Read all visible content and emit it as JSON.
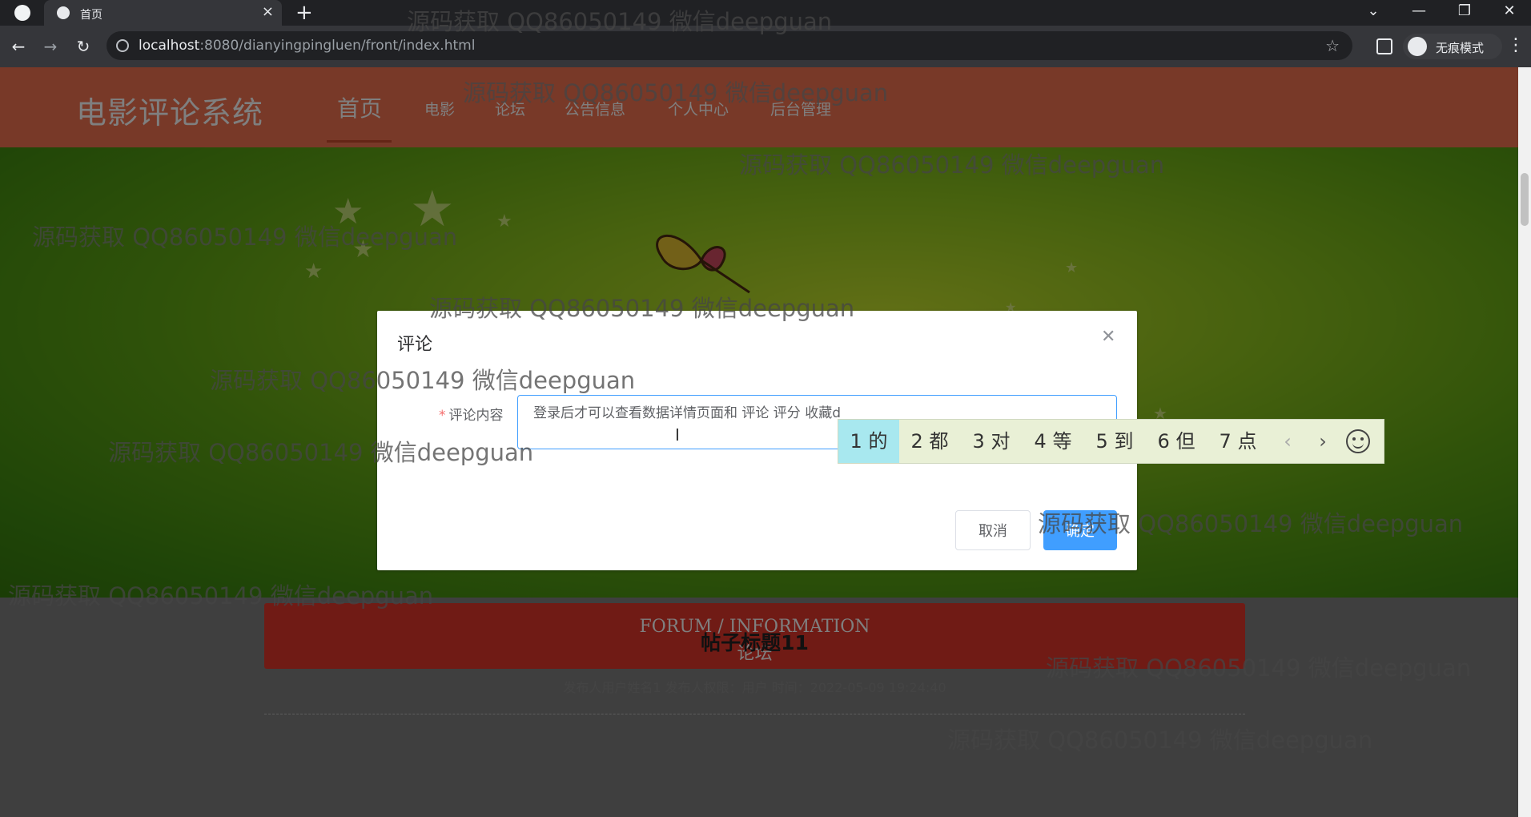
{
  "browser": {
    "tab_title": "首页",
    "url_host": "localhost",
    "url_rest": ":8080/dianyingpingluen/front/index.html",
    "incognito_label": "无痕模式"
  },
  "site": {
    "logo": "电影评论系统",
    "nav": [
      "首页",
      "电影",
      "论坛",
      "公告信息",
      "个人中心",
      "后台管理"
    ]
  },
  "forum": {
    "heading_en": "FORUM / INFORMATION",
    "heading_cn": "论坛"
  },
  "post": {
    "title": "帖子标题11",
    "meta": "发布人用户姓名1   发布人权限：用户   时间：2022-05-09 19:24:40"
  },
  "dialog": {
    "title": "评论",
    "field_label": "评论内容",
    "field_value": "登录后才可以查看数据详情页面和 评论 评分 收藏d",
    "cancel_label": "取消",
    "ok_label": "确定"
  },
  "ime": {
    "candidates": [
      "1 的",
      "2 都",
      "3 对",
      "4 等",
      "5 到",
      "6 但",
      "7 点"
    ],
    "prev_icon": "chevron-left-icon",
    "next_icon": "chevron-right-icon",
    "emoji_icon": "smiley-icon"
  },
  "watermark": "源码获取 QQ86050149 微信deepguan",
  "colors": {
    "header": "#f07250",
    "accent": "#409eff",
    "forum_bar": "#e1372b"
  }
}
